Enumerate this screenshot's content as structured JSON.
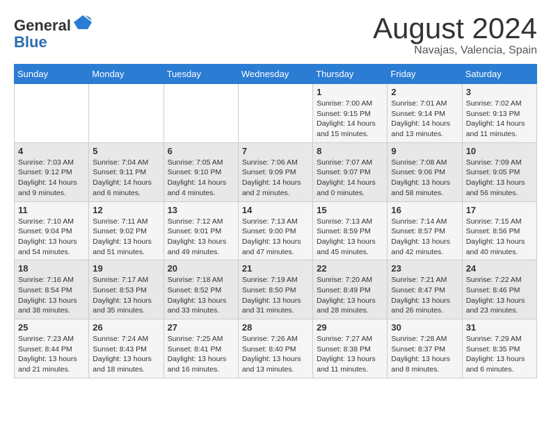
{
  "header": {
    "logo_line1": "General",
    "logo_line2": "Blue",
    "month_year": "August 2024",
    "location": "Navajas, Valencia, Spain"
  },
  "weekdays": [
    "Sunday",
    "Monday",
    "Tuesday",
    "Wednesday",
    "Thursday",
    "Friday",
    "Saturday"
  ],
  "weeks": [
    [
      {
        "day": "",
        "info": ""
      },
      {
        "day": "",
        "info": ""
      },
      {
        "day": "",
        "info": ""
      },
      {
        "day": "",
        "info": ""
      },
      {
        "day": "1",
        "info": "Sunrise: 7:00 AM\nSunset: 9:15 PM\nDaylight: 14 hours\nand 15 minutes."
      },
      {
        "day": "2",
        "info": "Sunrise: 7:01 AM\nSunset: 9:14 PM\nDaylight: 14 hours\nand 13 minutes."
      },
      {
        "day": "3",
        "info": "Sunrise: 7:02 AM\nSunset: 9:13 PM\nDaylight: 14 hours\nand 11 minutes."
      }
    ],
    [
      {
        "day": "4",
        "info": "Sunrise: 7:03 AM\nSunset: 9:12 PM\nDaylight: 14 hours\nand 9 minutes."
      },
      {
        "day": "5",
        "info": "Sunrise: 7:04 AM\nSunset: 9:11 PM\nDaylight: 14 hours\nand 6 minutes."
      },
      {
        "day": "6",
        "info": "Sunrise: 7:05 AM\nSunset: 9:10 PM\nDaylight: 14 hours\nand 4 minutes."
      },
      {
        "day": "7",
        "info": "Sunrise: 7:06 AM\nSunset: 9:09 PM\nDaylight: 14 hours\nand 2 minutes."
      },
      {
        "day": "8",
        "info": "Sunrise: 7:07 AM\nSunset: 9:07 PM\nDaylight: 14 hours\nand 0 minutes."
      },
      {
        "day": "9",
        "info": "Sunrise: 7:08 AM\nSunset: 9:06 PM\nDaylight: 13 hours\nand 58 minutes."
      },
      {
        "day": "10",
        "info": "Sunrise: 7:09 AM\nSunset: 9:05 PM\nDaylight: 13 hours\nand 56 minutes."
      }
    ],
    [
      {
        "day": "11",
        "info": "Sunrise: 7:10 AM\nSunset: 9:04 PM\nDaylight: 13 hours\nand 54 minutes."
      },
      {
        "day": "12",
        "info": "Sunrise: 7:11 AM\nSunset: 9:02 PM\nDaylight: 13 hours\nand 51 minutes."
      },
      {
        "day": "13",
        "info": "Sunrise: 7:12 AM\nSunset: 9:01 PM\nDaylight: 13 hours\nand 49 minutes."
      },
      {
        "day": "14",
        "info": "Sunrise: 7:13 AM\nSunset: 9:00 PM\nDaylight: 13 hours\nand 47 minutes."
      },
      {
        "day": "15",
        "info": "Sunrise: 7:13 AM\nSunset: 8:59 PM\nDaylight: 13 hours\nand 45 minutes."
      },
      {
        "day": "16",
        "info": "Sunrise: 7:14 AM\nSunset: 8:57 PM\nDaylight: 13 hours\nand 42 minutes."
      },
      {
        "day": "17",
        "info": "Sunrise: 7:15 AM\nSunset: 8:56 PM\nDaylight: 13 hours\nand 40 minutes."
      }
    ],
    [
      {
        "day": "18",
        "info": "Sunrise: 7:16 AM\nSunset: 8:54 PM\nDaylight: 13 hours\nand 38 minutes."
      },
      {
        "day": "19",
        "info": "Sunrise: 7:17 AM\nSunset: 8:53 PM\nDaylight: 13 hours\nand 35 minutes."
      },
      {
        "day": "20",
        "info": "Sunrise: 7:18 AM\nSunset: 8:52 PM\nDaylight: 13 hours\nand 33 minutes."
      },
      {
        "day": "21",
        "info": "Sunrise: 7:19 AM\nSunset: 8:50 PM\nDaylight: 13 hours\nand 31 minutes."
      },
      {
        "day": "22",
        "info": "Sunrise: 7:20 AM\nSunset: 8:49 PM\nDaylight: 13 hours\nand 28 minutes."
      },
      {
        "day": "23",
        "info": "Sunrise: 7:21 AM\nSunset: 8:47 PM\nDaylight: 13 hours\nand 26 minutes."
      },
      {
        "day": "24",
        "info": "Sunrise: 7:22 AM\nSunset: 8:46 PM\nDaylight: 13 hours\nand 23 minutes."
      }
    ],
    [
      {
        "day": "25",
        "info": "Sunrise: 7:23 AM\nSunset: 8:44 PM\nDaylight: 13 hours\nand 21 minutes."
      },
      {
        "day": "26",
        "info": "Sunrise: 7:24 AM\nSunset: 8:43 PM\nDaylight: 13 hours\nand 18 minutes."
      },
      {
        "day": "27",
        "info": "Sunrise: 7:25 AM\nSunset: 8:41 PM\nDaylight: 13 hours\nand 16 minutes."
      },
      {
        "day": "28",
        "info": "Sunrise: 7:26 AM\nSunset: 8:40 PM\nDaylight: 13 hours\nand 13 minutes."
      },
      {
        "day": "29",
        "info": "Sunrise: 7:27 AM\nSunset: 8:38 PM\nDaylight: 13 hours\nand 11 minutes."
      },
      {
        "day": "30",
        "info": "Sunrise: 7:28 AM\nSunset: 8:37 PM\nDaylight: 13 hours\nand 8 minutes."
      },
      {
        "day": "31",
        "info": "Sunrise: 7:29 AM\nSunset: 8:35 PM\nDaylight: 13 hours\nand 6 minutes."
      }
    ]
  ]
}
